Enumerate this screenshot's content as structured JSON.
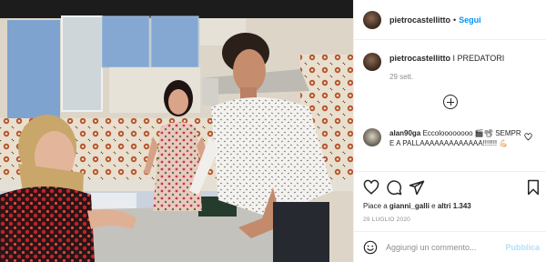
{
  "post": {
    "author": "pietrocastellitto",
    "separator": "•",
    "follow_label": "Segui"
  },
  "caption": {
    "author": "pietrocastellitto",
    "text": " I PREDATORI",
    "date": "29 sett."
  },
  "comment": {
    "author": "alan90ga",
    "text": " Eccoloooooooo 🎬📽 SEMPRE A PALLAAAAAAAAAAAAA!!!!!!! 💪🏻"
  },
  "likes": {
    "prefix": "Piace a ",
    "user": "gianni_galli",
    "connector": " e ",
    "others": "altri 1.343"
  },
  "post_date": "29 LUGLIO 2020",
  "comment_box": {
    "placeholder": "Aggiungi un commento...",
    "publish_label": "Pubblica"
  },
  "colors": {
    "follow": "#0095f6",
    "publish_disabled": "#b2dffc",
    "muted": "#8e8e8e"
  },
  "icons": [
    "heart-icon",
    "comment-icon",
    "share-icon",
    "bookmark-icon",
    "emoji-icon",
    "plus-circle-icon"
  ]
}
